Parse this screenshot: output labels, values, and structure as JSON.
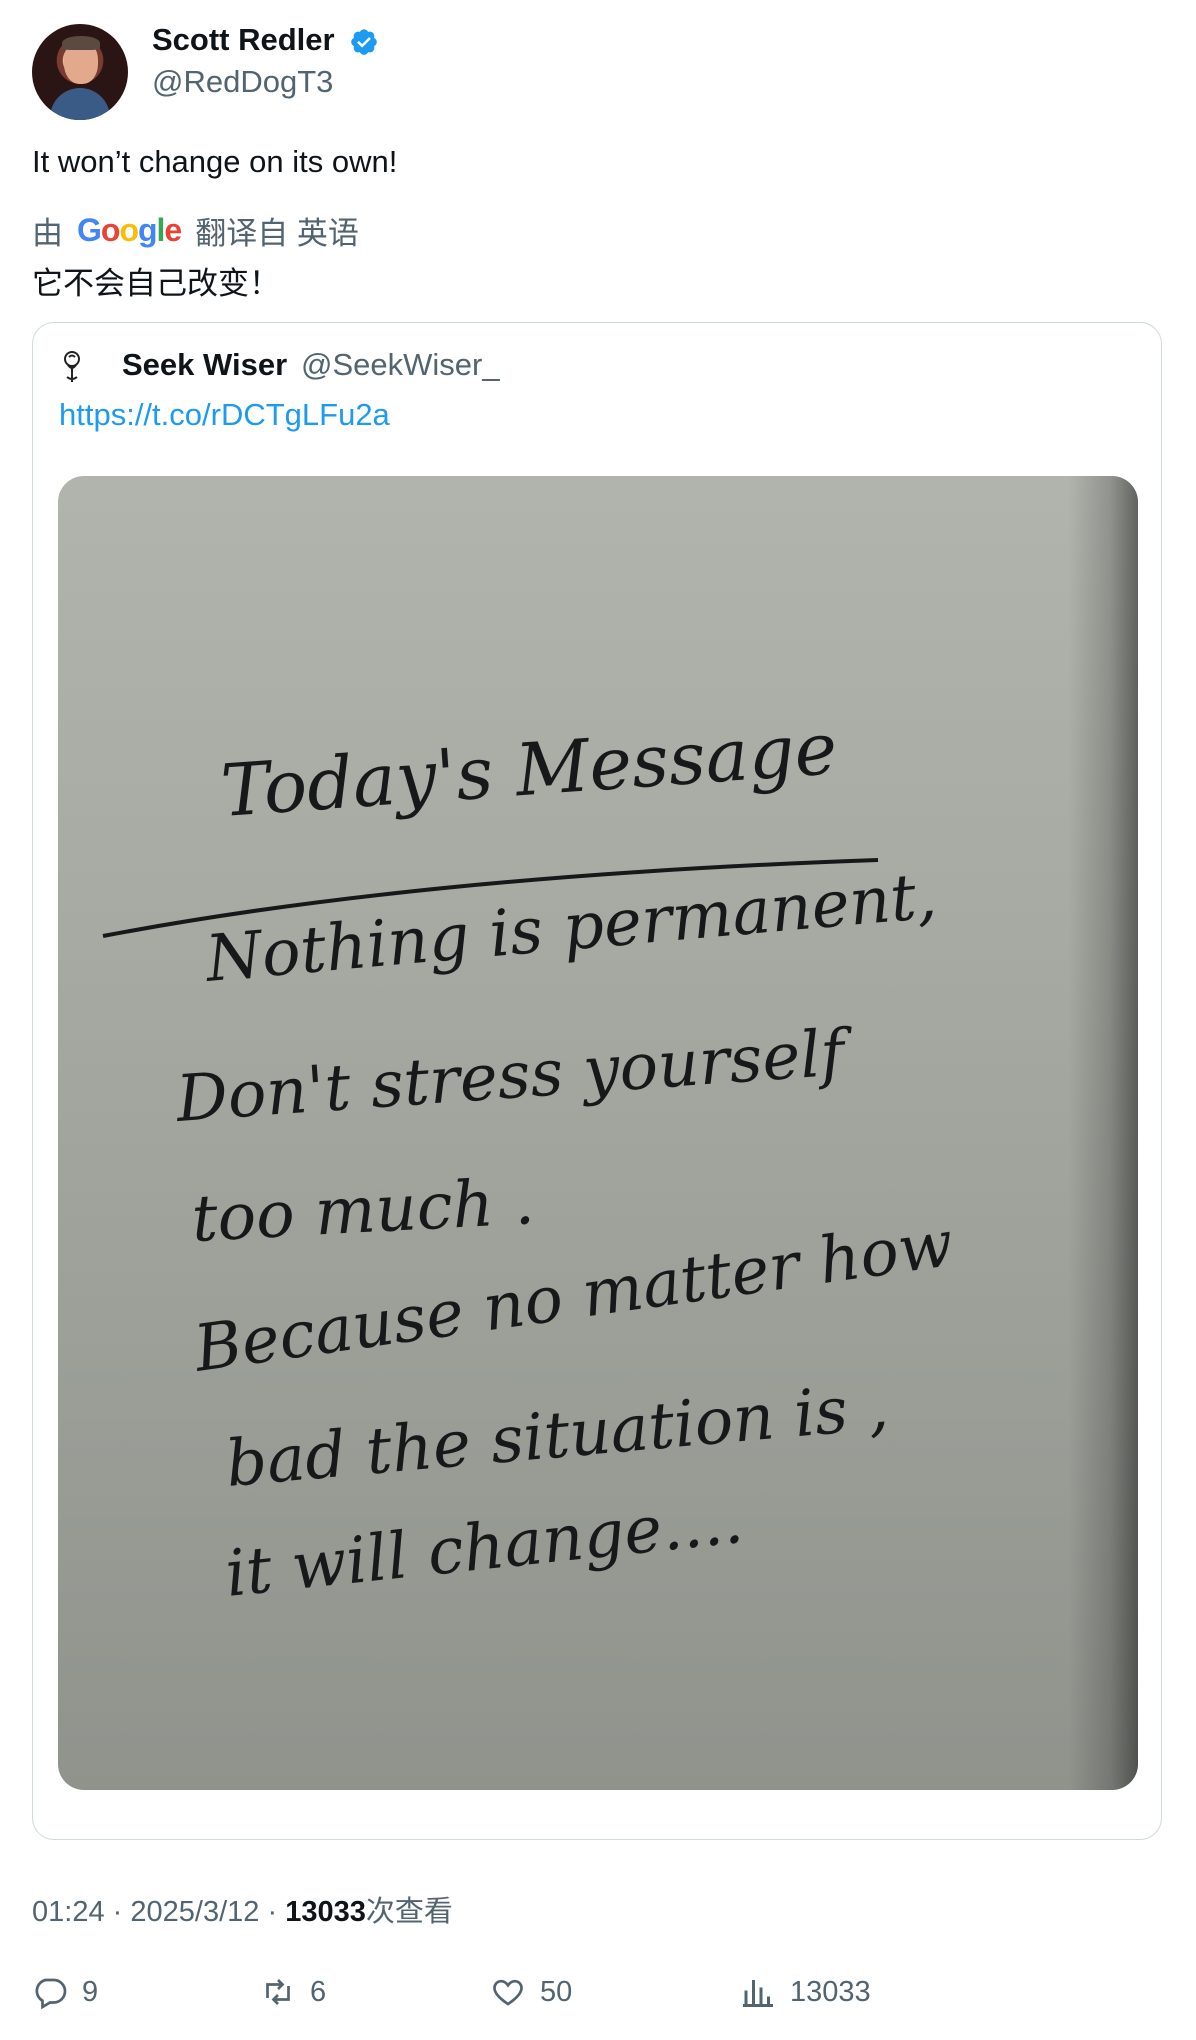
{
  "author": {
    "name": "Scott Redler",
    "handle": "@RedDogT3",
    "verified": true,
    "avatar_icon": "profile-photo"
  },
  "tweet": {
    "text": "It won’t change on its own!",
    "translation": {
      "prefix": "由",
      "provider": "Google",
      "suffix": "翻译自 英语",
      "text": "它不会自己改变！"
    }
  },
  "quoted_tweet": {
    "name": "Seek Wiser",
    "handle": "@SeekWiser_",
    "link": "https://t.co/rDCTgLFu2a",
    "image_text": {
      "title": "Today's Message",
      "lines": [
        "Nothing is permanent,",
        "Don't stress yourself",
        "too much .",
        "Because no matter how",
        "bad the situation is ,",
        "it will change...."
      ]
    }
  },
  "meta": {
    "time": "01:24",
    "separator": "·",
    "date": "2025/3/12",
    "views": "13033",
    "views_suffix": "次查看"
  },
  "actions": {
    "replies": "9",
    "retweets": "6",
    "likes": "50",
    "views": "13033"
  },
  "colors": {
    "link": "#1d9bf0",
    "secondary_text": "#536471",
    "border": "#cfd9de"
  }
}
